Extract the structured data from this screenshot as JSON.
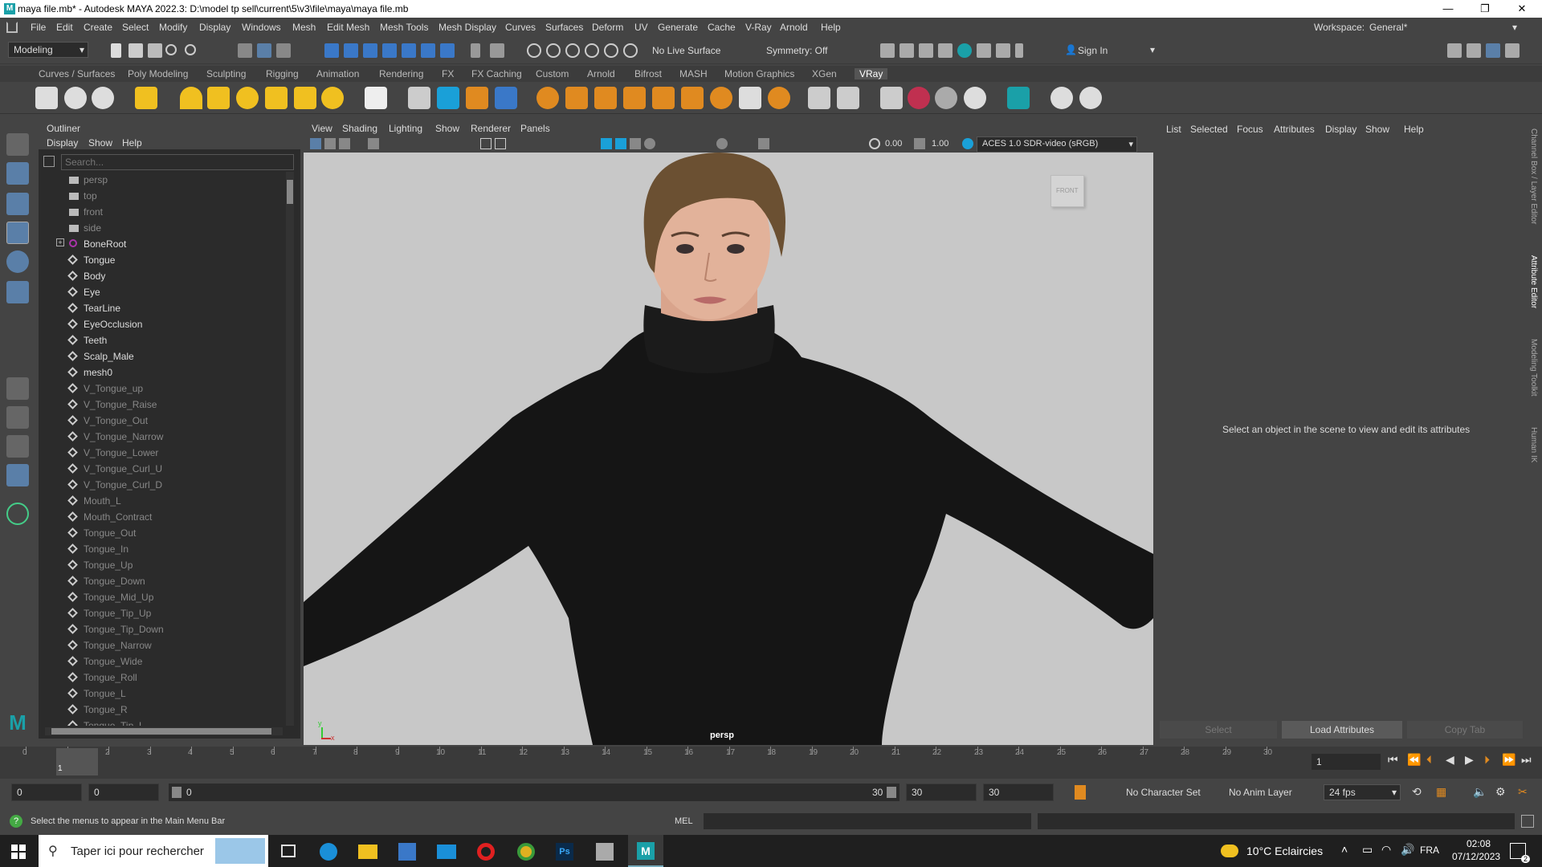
{
  "window": {
    "title": "maya file.mb* - Autodesk MAYA 2022.3: D:\\model tp sell\\current\\5\\v3\\file\\maya\\maya file.mb",
    "minimize": "—",
    "maximize": "❐",
    "close": "✕"
  },
  "menubar": {
    "items": [
      "File",
      "Edit",
      "Create",
      "Select",
      "Modify",
      "Display",
      "Windows",
      "Mesh",
      "Edit Mesh",
      "Mesh Tools",
      "Mesh Display",
      "Curves",
      "Surfaces",
      "Deform",
      "UV",
      "Generate",
      "Cache",
      "V-Ray",
      "Arnold",
      "Help"
    ],
    "workspace_label": "Workspace:",
    "workspace_value": "General*"
  },
  "toolbar": {
    "mode": "Modeling",
    "live_surface": "No Live Surface",
    "symmetry": "Symmetry: Off",
    "sign_in": "Sign In"
  },
  "shelf": {
    "tabs": [
      "Curves / Surfaces",
      "Poly Modeling",
      "Sculpting",
      "Rigging",
      "Animation",
      "Rendering",
      "FX",
      "FX Caching",
      "Custom",
      "Arnold",
      "Bifrost",
      "MASH",
      "Motion Graphics",
      "XGen",
      "VRay"
    ],
    "active_tab": "VRay"
  },
  "outliner": {
    "title": "Outliner",
    "menu": [
      "Display",
      "Show",
      "Help"
    ],
    "search_placeholder": "Search...",
    "items": [
      {
        "label": "persp",
        "type": "camera",
        "dim": true
      },
      {
        "label": "top",
        "type": "camera",
        "dim": true
      },
      {
        "label": "front",
        "type": "camera",
        "dim": true
      },
      {
        "label": "side",
        "type": "camera",
        "dim": true
      },
      {
        "label": "BoneRoot",
        "type": "joint",
        "dim": false
      },
      {
        "label": "Tongue",
        "type": "mesh",
        "dim": false
      },
      {
        "label": "Body",
        "type": "mesh",
        "dim": false
      },
      {
        "label": "Eye",
        "type": "mesh",
        "dim": false
      },
      {
        "label": "TearLine",
        "type": "mesh",
        "dim": false
      },
      {
        "label": "EyeOcclusion",
        "type": "mesh",
        "dim": false
      },
      {
        "label": "Teeth",
        "type": "mesh",
        "dim": false
      },
      {
        "label": "Scalp_Male",
        "type": "mesh",
        "dim": false
      },
      {
        "label": "mesh0",
        "type": "mesh",
        "dim": false
      },
      {
        "label": "V_Tongue_up",
        "type": "mesh",
        "dim": true
      },
      {
        "label": "V_Tongue_Raise",
        "type": "mesh",
        "dim": true
      },
      {
        "label": "V_Tongue_Out",
        "type": "mesh",
        "dim": true
      },
      {
        "label": "V_Tongue_Narrow",
        "type": "mesh",
        "dim": true
      },
      {
        "label": "V_Tongue_Lower",
        "type": "mesh",
        "dim": true
      },
      {
        "label": "V_Tongue_Curl_U",
        "type": "mesh",
        "dim": true
      },
      {
        "label": "V_Tongue_Curl_D",
        "type": "mesh",
        "dim": true
      },
      {
        "label": "Mouth_L",
        "type": "mesh",
        "dim": true
      },
      {
        "label": "Mouth_Contract",
        "type": "mesh",
        "dim": true
      },
      {
        "label": "Tongue_Out",
        "type": "mesh",
        "dim": true
      },
      {
        "label": "Tongue_In",
        "type": "mesh",
        "dim": true
      },
      {
        "label": "Tongue_Up",
        "type": "mesh",
        "dim": true
      },
      {
        "label": "Tongue_Down",
        "type": "mesh",
        "dim": true
      },
      {
        "label": "Tongue_Mid_Up",
        "type": "mesh",
        "dim": true
      },
      {
        "label": "Tongue_Tip_Up",
        "type": "mesh",
        "dim": true
      },
      {
        "label": "Tongue_Tip_Down",
        "type": "mesh",
        "dim": true
      },
      {
        "label": "Tongue_Narrow",
        "type": "mesh",
        "dim": true
      },
      {
        "label": "Tongue_Wide",
        "type": "mesh",
        "dim": true
      },
      {
        "label": "Tongue_Roll",
        "type": "mesh",
        "dim": true
      },
      {
        "label": "Tongue_L",
        "type": "mesh",
        "dim": true
      },
      {
        "label": "Tongue_R",
        "type": "mesh",
        "dim": true
      },
      {
        "label": "Tongue_Tip_L",
        "type": "mesh",
        "dim": true
      }
    ]
  },
  "viewport": {
    "menu": [
      "View",
      "Shading",
      "Lighting",
      "Show",
      "Renderer",
      "Panels"
    ],
    "exposure": "0.00",
    "gamma": "1.00",
    "color_space": "ACES 1.0 SDR-video (sRGB)",
    "camera_label": "persp",
    "viewcube_label": "FRONT",
    "axis_y": "y",
    "axis_x": "x"
  },
  "attribute_editor": {
    "menu": [
      "List",
      "Selected",
      "Focus",
      "Attributes",
      "Display",
      "Show",
      "Help"
    ],
    "empty_message": "Select an object in the scene to view and edit its attributes",
    "buttons": [
      "Select",
      "Load Attributes",
      "Copy Tab"
    ],
    "side_tabs": [
      "Channel Box / Layer Editor",
      "Attribute Editor",
      "Modeling Toolkit",
      "Human IK"
    ]
  },
  "timeline": {
    "ticks": [
      "0",
      "1",
      "2",
      "3",
      "4",
      "5",
      "6",
      "7",
      "8",
      "9",
      "10",
      "11",
      "12",
      "13",
      "14",
      "15",
      "16",
      "17",
      "18",
      "19",
      "20",
      "21",
      "22",
      "23",
      "24",
      "25",
      "26",
      "27",
      "28",
      "29",
      "30"
    ],
    "current_frame_marker": "1",
    "current_frame": "1"
  },
  "range": {
    "start": "0",
    "playback_start": "0",
    "slider_start": "0",
    "slider_end": "30",
    "playback_end": "30",
    "end": "30",
    "character_set": "No Character Set",
    "anim_layer": "No Anim Layer",
    "fps": "24 fps"
  },
  "status": {
    "message": "Select the menus to appear in the Main Menu Bar",
    "mel_label": "MEL"
  },
  "taskbar": {
    "search_placeholder": "Taper ici pour rechercher",
    "weather": "10°C  Eclaircies",
    "language": "FRA",
    "time": "02:08",
    "date": "07/12/2023",
    "notifications": "2"
  },
  "colors": {
    "maya_accent": "#1aa0a8",
    "panel_dark": "#2b2b2b",
    "panel": "#444444",
    "viewport_bg": "#c8c8c8",
    "shelf_yellow": "#f0c020"
  }
}
